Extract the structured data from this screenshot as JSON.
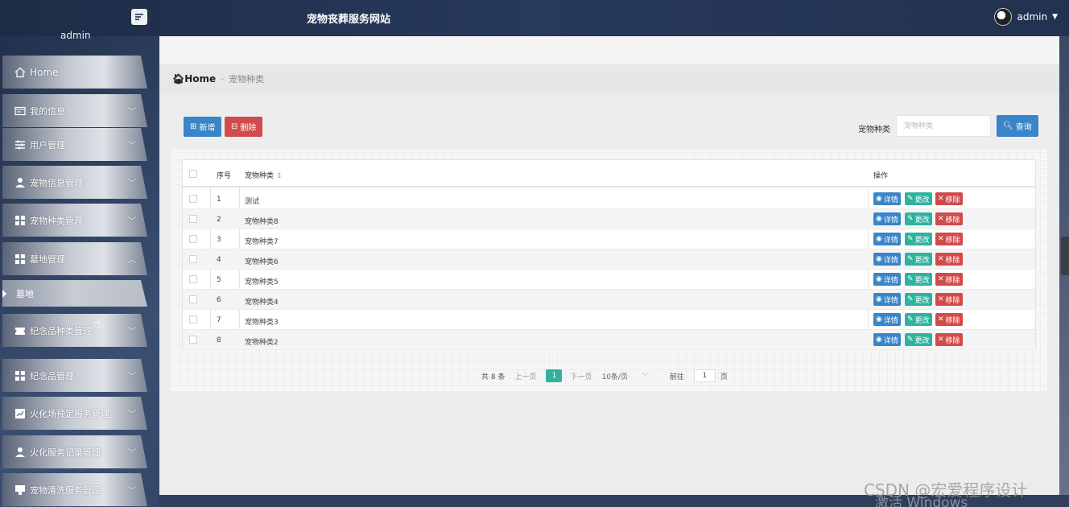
{
  "header": {
    "site_title": "宠物丧葬服务网站",
    "username": "admin"
  },
  "sidebar": {
    "username": "admin",
    "items": [
      {
        "label": "Home"
      },
      {
        "label": "我的信息"
      },
      {
        "label": "用户管理"
      },
      {
        "label": "宠物信息管理"
      },
      {
        "label": "宠物种类管理"
      },
      {
        "label": "墓地管理"
      },
      {
        "label": "纪念品种类管理"
      },
      {
        "label": "纪念品管理"
      },
      {
        "label": "火化场预定服务管理"
      },
      {
        "label": "火化服务记录管理"
      },
      {
        "label": "宠物清洗服务管理"
      }
    ],
    "sub_item": "墓地"
  },
  "breadcrumb": {
    "home": "Home",
    "separator": "-",
    "current": "宠物种类"
  },
  "toolbar": {
    "add_label": "新增",
    "delete_label": "删除",
    "search_label": "宠物种类",
    "search_placeholder": "宠物种类",
    "search_button": "查询"
  },
  "table": {
    "headers": {
      "index": "序号",
      "type": "宠物种类",
      "actions": "操作"
    },
    "rows": [
      {
        "index": "1",
        "type": "测试"
      },
      {
        "index": "2",
        "type": "宠物种类8"
      },
      {
        "index": "3",
        "type": "宠物种类7"
      },
      {
        "index": "4",
        "type": "宠物种类6"
      },
      {
        "index": "5",
        "type": "宠物种类5"
      },
      {
        "index": "6",
        "type": "宠物种类4"
      },
      {
        "index": "7",
        "type": "宠物种类3"
      },
      {
        "index": "8",
        "type": "宠物种类2"
      }
    ],
    "actions": {
      "detail": "详情",
      "edit": "更改",
      "remove": "移除"
    }
  },
  "pagination": {
    "total": "共 8 条",
    "prev": "上一页",
    "current_page": "1",
    "next": "下一页",
    "page_size": "10条/页",
    "goto_label": "前往",
    "goto_value": "1",
    "goto_suffix": "页"
  },
  "watermarks": {
    "csdn": "CSDN @宏爱程序设计",
    "activate": "激活 Windows"
  },
  "colors": {
    "primary": "#3a84c8",
    "danger": "#d14b4b",
    "success": "#2fb3a0",
    "header_bg": "#22324f"
  }
}
